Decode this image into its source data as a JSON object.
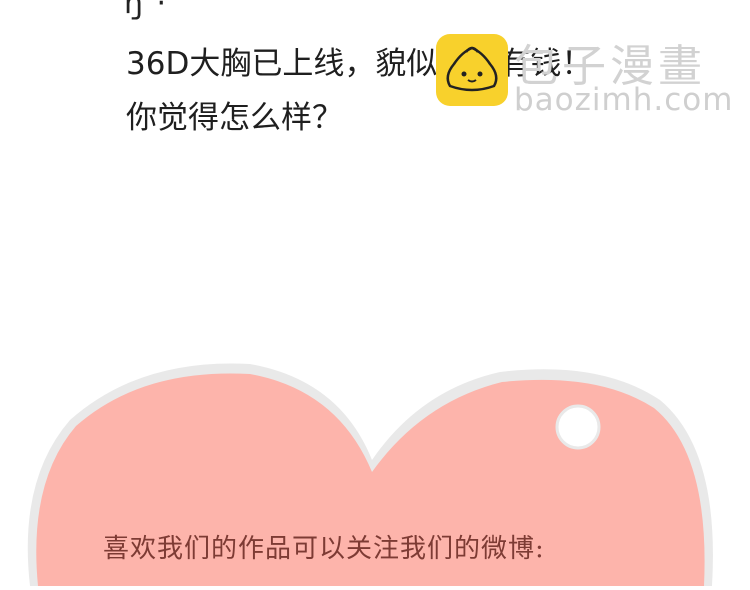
{
  "panel": {
    "top_fragment": "ŋ ·",
    "lines": [
      "36D大胸已上线，貌似还很有钱！",
      "你觉得怎么样？"
    ]
  },
  "watermark": {
    "brand": "包子漫畫",
    "url": "baozimh.com",
    "logo_icon": "bun-mascot-icon",
    "logo_color": "#f8d12c"
  },
  "heart": {
    "fill_color": "#fdb4ab",
    "outline_color": "#e9e9e9",
    "caption": "喜欢我们的作品可以关注我们的微博:"
  }
}
